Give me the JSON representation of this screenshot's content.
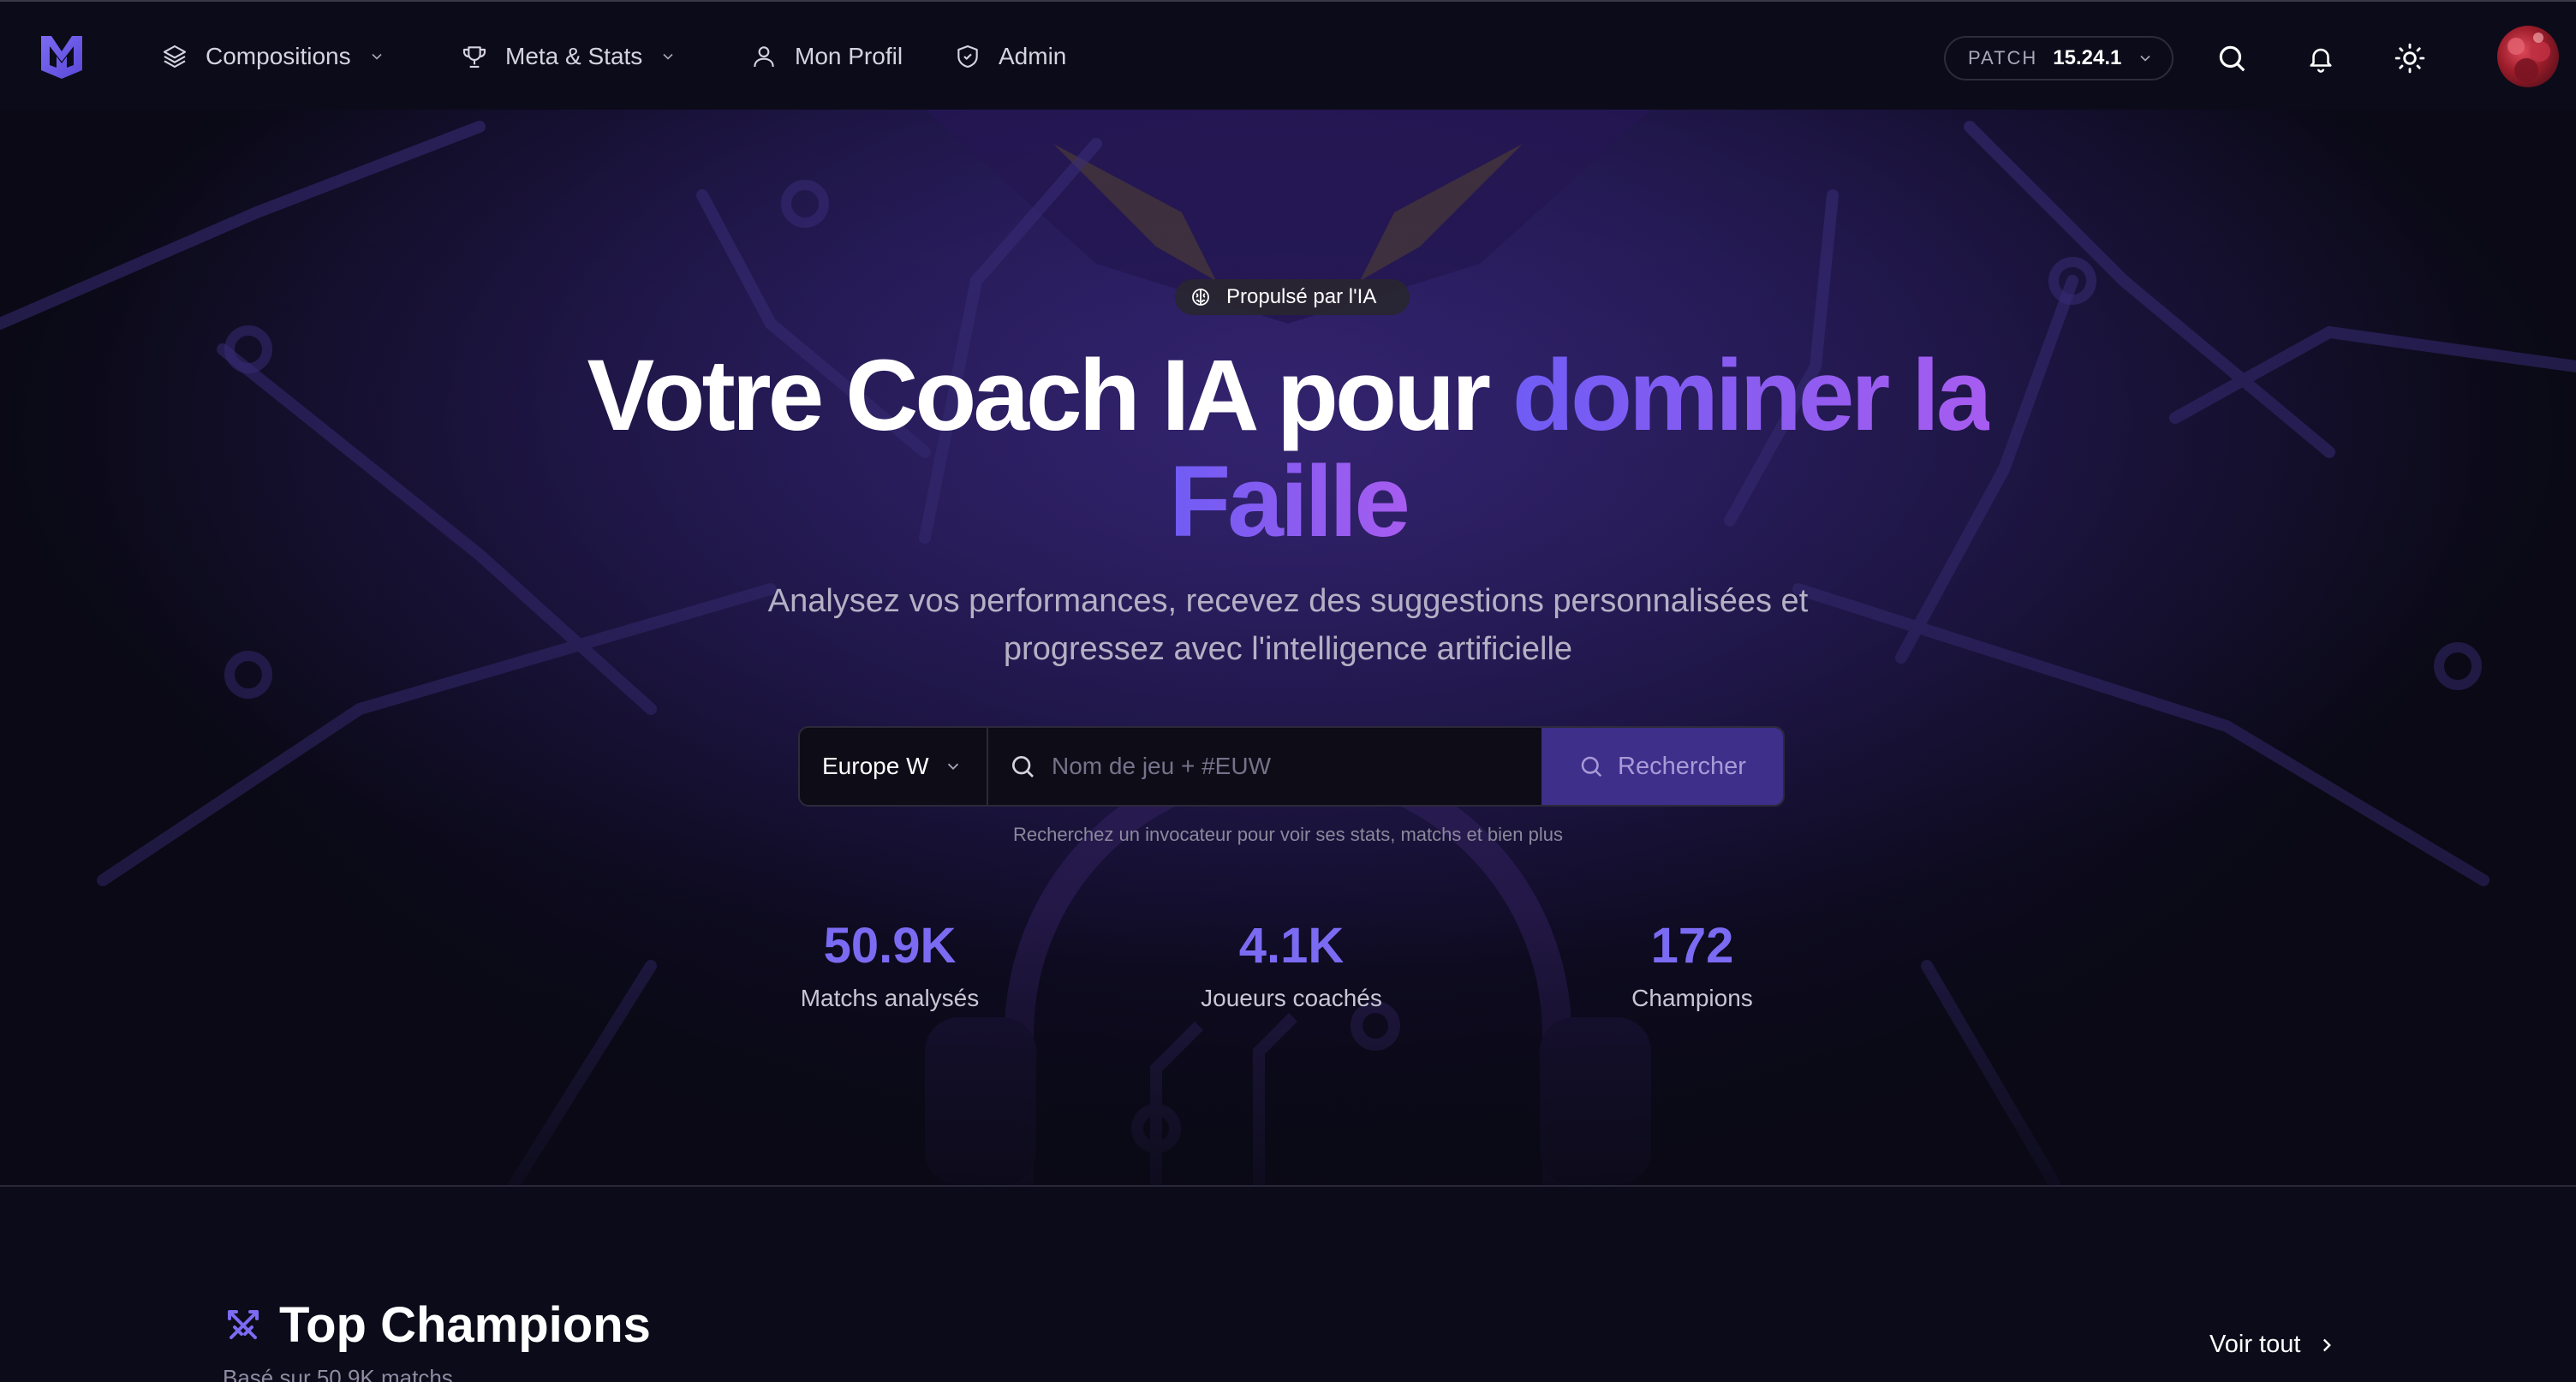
{
  "nav": {
    "items": [
      {
        "label": "Compositions",
        "icon": "layers-icon",
        "dropdown": true
      },
      {
        "label": "Meta & Stats",
        "icon": "trophy-icon",
        "dropdown": true
      },
      {
        "label": "Mon Profil",
        "icon": "user-icon",
        "dropdown": false
      },
      {
        "label": "Admin",
        "icon": "shield-icon",
        "dropdown": false
      }
    ],
    "patch_label": "PATCH",
    "patch_value": "15.24.1",
    "icons": [
      "search-icon",
      "bell-icon",
      "sun-icon"
    ]
  },
  "hero": {
    "badge": "Propulsé par l'IA",
    "title_plain": "Votre Coach IA pour ",
    "title_accent_1": "dominer la",
    "title_accent_2": "Faille",
    "subtitle": "Analysez vos performances, recevez des suggestions personnalisées et progressez avec l'intelligence artificielle",
    "search": {
      "region": "Europe W",
      "placeholder": "Nom de jeu + #EUW",
      "button": "Rechercher",
      "hint": "Recherchez un invocateur pour voir ses stats, matchs et bien plus"
    },
    "stats": [
      {
        "value": "50.9K",
        "label": "Matchs analysés"
      },
      {
        "value": "4.1K",
        "label": "Joueurs coachés"
      },
      {
        "value": "172",
        "label": "Champions"
      }
    ]
  },
  "section": {
    "title": "Top Champions",
    "subtitle": "Basé sur 50.9K matchs",
    "see_all": "Voir tout"
  },
  "colors": {
    "accent": "#7b6bf2",
    "accent_purple": "#a75cf0",
    "background": "#0b0a18",
    "button": "#3d2f8a"
  }
}
